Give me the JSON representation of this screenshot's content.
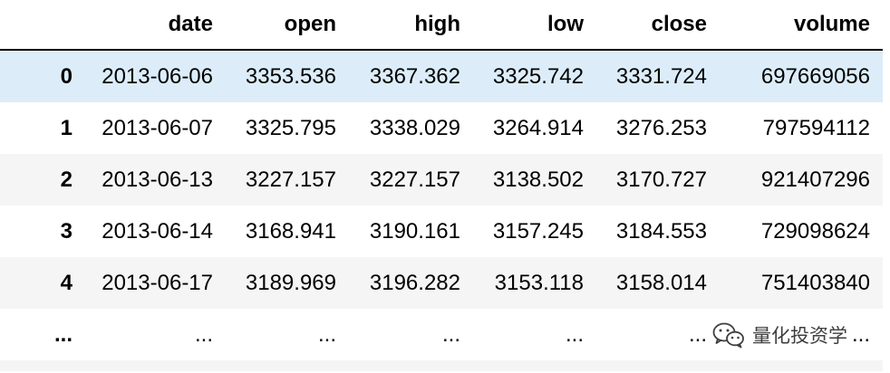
{
  "table": {
    "columns": [
      "",
      "date",
      "open",
      "high",
      "low",
      "close",
      "volume"
    ],
    "rows": [
      {
        "index": "0",
        "date": "2013-06-06",
        "open": "3353.536",
        "high": "3367.362",
        "low": "3325.742",
        "close": "3331.724",
        "volume": "697669056"
      },
      {
        "index": "1",
        "date": "2013-06-07",
        "open": "3325.795",
        "high": "3338.029",
        "low": "3264.914",
        "close": "3276.253",
        "volume": "797594112"
      },
      {
        "index": "2",
        "date": "2013-06-13",
        "open": "3227.157",
        "high": "3227.157",
        "low": "3138.502",
        "close": "3170.727",
        "volume": "921407296"
      },
      {
        "index": "3",
        "date": "2013-06-14",
        "open": "3168.941",
        "high": "3190.161",
        "low": "3157.245",
        "close": "3184.553",
        "volume": "729098624"
      },
      {
        "index": "4",
        "date": "2013-06-17",
        "open": "3189.969",
        "high": "3196.282",
        "low": "3153.118",
        "close": "3158.014",
        "volume": "751403840"
      },
      {
        "index": "...",
        "date": "...",
        "open": "...",
        "high": "...",
        "low": "...",
        "close": "...",
        "volume": "..."
      }
    ]
  },
  "watermark": {
    "text": "量化投资学",
    "icon": "wechat-icon"
  },
  "colors": {
    "hover_row": "#dcedf9",
    "striped_row": "#f5f5f5"
  }
}
